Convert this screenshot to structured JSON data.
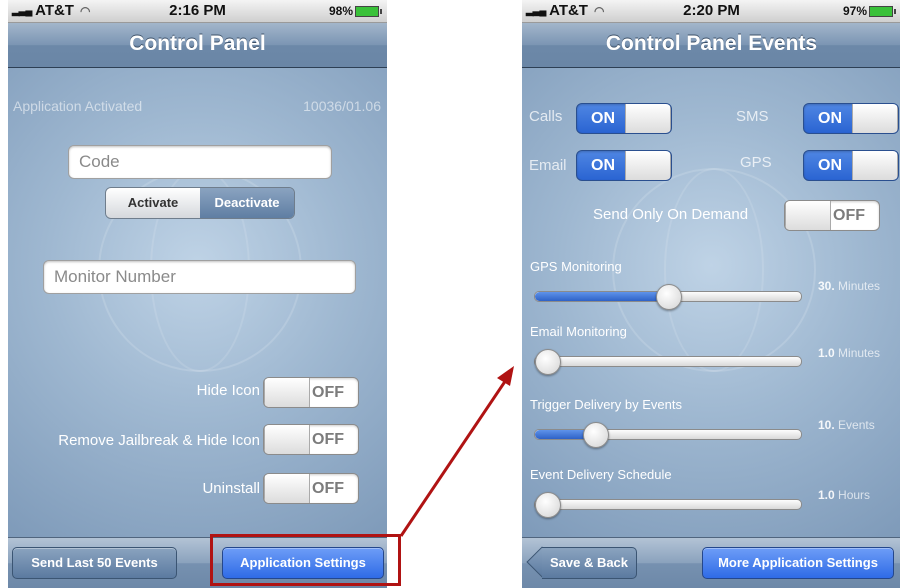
{
  "left_screen": {
    "status": {
      "carrier": "AT&T",
      "time": "2:16 PM",
      "battery": "98%"
    },
    "title": "Control Panel",
    "activation_status": "Application Activated",
    "version": "10036/01.06",
    "code_placeholder": "Code",
    "segment": {
      "activate": "Activate",
      "deactivate": "Deactivate"
    },
    "monitor_placeholder": "Monitor Number",
    "toggles": [
      {
        "label": "Hide Icon",
        "state": "OFF"
      },
      {
        "label": "Remove Jailbreak & Hide Icon",
        "state": "OFF"
      },
      {
        "label": "Uninstall",
        "state": "OFF"
      }
    ],
    "toolbar": {
      "left_button": "Send Last 50 Events",
      "right_button": "Application Settings"
    }
  },
  "right_screen": {
    "status": {
      "carrier": "AT&T",
      "time": "2:20 PM",
      "battery": "97%"
    },
    "title": "Control Panel Events",
    "toggles": {
      "calls": {
        "label": "Calls",
        "state": "ON"
      },
      "sms": {
        "label": "SMS",
        "state": "ON"
      },
      "email": {
        "label": "Email",
        "state": "ON"
      },
      "gps": {
        "label": "GPS",
        "state": "ON"
      },
      "send_on_demand": {
        "label": "Send Only On Demand",
        "state": "OFF"
      }
    },
    "sliders": [
      {
        "label": "GPS Monitoring",
        "value": "30.",
        "unit": "Minutes",
        "level": 0.5
      },
      {
        "label": "Email Monitoring",
        "value": "1.0",
        "unit": "Minutes",
        "level": 0.0
      },
      {
        "label": "Trigger Delivery by Events",
        "value": "10.",
        "unit": "Events",
        "level": 0.2
      },
      {
        "label": "Event Delivery Schedule",
        "value": "1.0",
        "unit": "Hours",
        "level": 0.0
      }
    ],
    "toolbar": {
      "back_button": "Save & Back",
      "right_button": "More Application Settings"
    }
  },
  "colors": {
    "accent_blue": "#2f6be6",
    "highlight_red": "#b01313",
    "nav_blue": "#7b95b3"
  }
}
